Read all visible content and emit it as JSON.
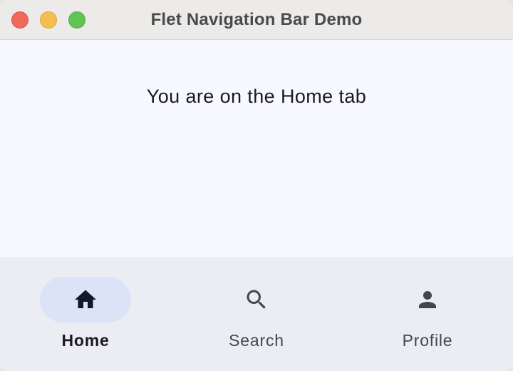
{
  "window": {
    "title": "Flet Navigation Bar Demo"
  },
  "content": {
    "message": "You are on the Home tab"
  },
  "navigation_bar": {
    "selected_index": 0,
    "destinations": [
      {
        "label": "Home",
        "icon": "home-icon",
        "selected": true
      },
      {
        "label": "Search",
        "icon": "search-icon",
        "selected": false
      },
      {
        "label": "Profile",
        "icon": "person-icon",
        "selected": false
      }
    ]
  },
  "colors": {
    "indicator": "#dce3f7",
    "navbar_background": "#ecedf2",
    "content_background": "#f8f9fe",
    "selected_icon": "#111827",
    "unselected_icon": "#44464f"
  }
}
